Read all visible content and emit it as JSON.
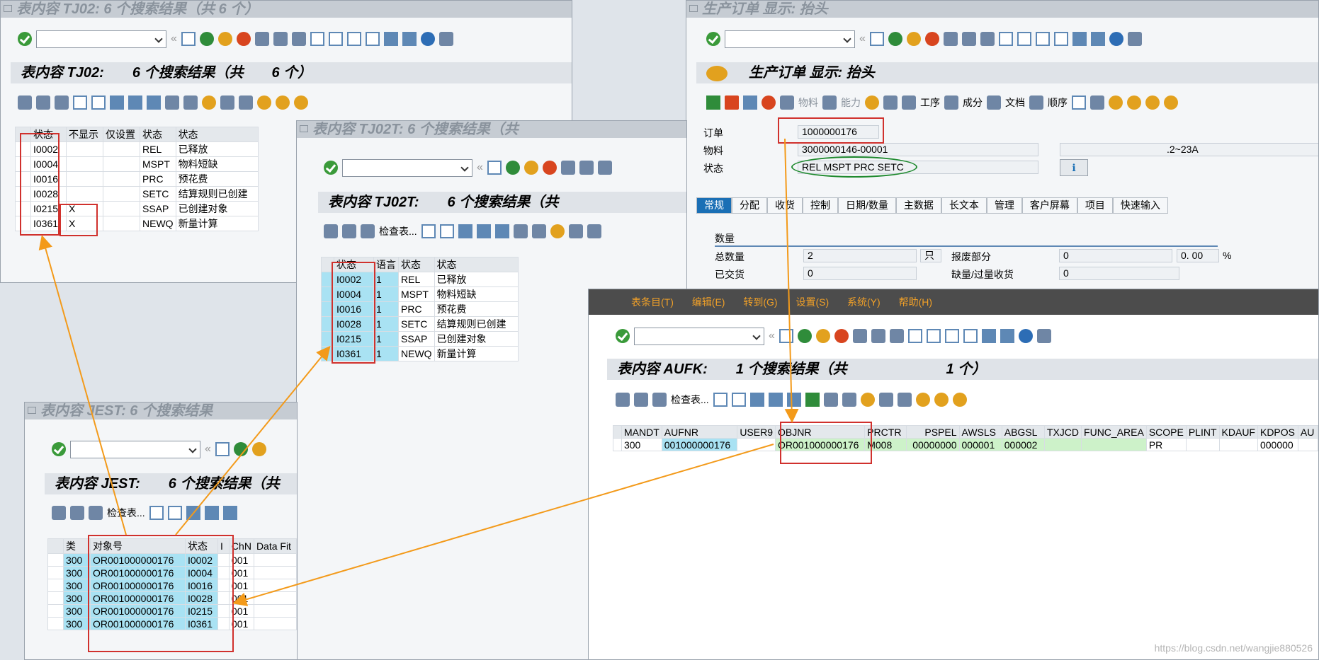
{
  "tj02_win": {
    "title": "表内容 TJ02:       6 个搜索结果（共            6 个）",
    "header": [
      "表内容 TJ02:",
      "6 个搜索结果（共",
      "6 个）"
    ],
    "columns": [
      "状态",
      "不显示",
      "仅设置",
      "状态",
      "状态"
    ],
    "rows": [
      [
        "I0002",
        "",
        "",
        "REL",
        "已释放"
      ],
      [
        "I0004",
        "",
        "",
        "MSPT",
        "物料短缺"
      ],
      [
        "I0016",
        "",
        "",
        "PRC",
        "预花费"
      ],
      [
        "I0028",
        "",
        "",
        "SETC",
        "结算规则已创建"
      ],
      [
        "I0215",
        "X",
        "",
        "SSAP",
        "已创建对象"
      ],
      [
        "I0361",
        "X",
        "",
        "NEWQ",
        "新量计算"
      ]
    ]
  },
  "tj02t_win": {
    "title": "表内容 TJ02T:      6 个搜索结果（共",
    "header": [
      "表内容 TJ02T:",
      "6 个搜索结果（共"
    ],
    "check_table": "检查表...",
    "columns": [
      "状态",
      "语言",
      "状态",
      "状态"
    ],
    "rows": [
      [
        "I0002",
        "1",
        "REL",
        "已释放"
      ],
      [
        "I0004",
        "1",
        "MSPT",
        "物料短缺"
      ],
      [
        "I0016",
        "1",
        "PRC",
        "预花费"
      ],
      [
        "I0028",
        "1",
        "SETC",
        "结算规则已创建"
      ],
      [
        "I0215",
        "1",
        "SSAP",
        "已创建对象"
      ],
      [
        "I0361",
        "1",
        "NEWQ",
        "新量计算"
      ]
    ]
  },
  "jest_win": {
    "title": "表内容 JEST:      6 个搜索结果",
    "header": [
      "表内容 JEST:",
      "6 个搜索结果（共"
    ],
    "check_table": "检查表...",
    "columns": [
      "类",
      "对象号",
      "状态",
      "I",
      "ChN",
      "Data Fit"
    ],
    "rows": [
      [
        "300",
        "OR001000000176",
        "I0002",
        "",
        "001",
        ""
      ],
      [
        "300",
        "OR001000000176",
        "I0004",
        "",
        "001",
        ""
      ],
      [
        "300",
        "OR001000000176",
        "I0016",
        "",
        "001",
        ""
      ],
      [
        "300",
        "OR001000000176",
        "I0028",
        "",
        "001",
        ""
      ],
      [
        "300",
        "OR001000000176",
        "I0215",
        "",
        "001",
        ""
      ],
      [
        "300",
        "OR001000000176",
        "I0361",
        "",
        "001",
        ""
      ]
    ]
  },
  "order_win": {
    "title": "生产订单 显示: 抬头",
    "header": "生产订单 显示: 抬头",
    "toolbar": [
      "物料",
      "能力",
      "工序",
      "成分",
      "文档",
      "顺序"
    ],
    "fields": {
      "order_label": "订单",
      "order_value": "1000000176",
      "material_label": "物料",
      "material_value": "3000000146-00001",
      "material_desc": ".2~23A",
      "status_label": "状态",
      "status_value": "REL  MSPT PRC  SETC"
    },
    "tabs": [
      "常规",
      "分配",
      "收货",
      "控制",
      "日期/数量",
      "主数据",
      "长文本",
      "管理",
      "客户屏幕",
      "项目",
      "快速输入"
    ],
    "qty": {
      "section": "数量",
      "total_label": "总数量",
      "total_value": "2",
      "unit": "只",
      "scrap_label": "报废部分",
      "scrap_value": "0",
      "scrap_pct": "0. 00",
      "pct": "%",
      "delivered_label": "已交货",
      "delivered_value": "0",
      "shortage_label": "缺量/过量收货",
      "shortage_value": "0"
    }
  },
  "aufk_win": {
    "menu": [
      "表条目(T)",
      "编辑(E)",
      "转到(G)",
      "设置(S)",
      "系统(Y)",
      "帮助(H)"
    ],
    "header": [
      "表内容 AUFK:",
      "1 个搜索结果（共",
      "1 个）"
    ],
    "check_table": "检查表...",
    "columns": [
      "MANDT",
      "AUFNR",
      "USER9",
      "OBJNR",
      "PRCTR",
      "PSPEL",
      "AWSLS",
      "ABGSL",
      "TXJCD",
      "FUNC_AREA",
      "SCOPE",
      "PLINT",
      "KDAUF",
      "KDPOS",
      "AU"
    ],
    "row": [
      "300",
      "001000000176",
      "",
      "OR001000000176",
      "M008",
      "00000000",
      "000001",
      "000002",
      "",
      "",
      "PR",
      "",
      "",
      "000000",
      ""
    ]
  },
  "watermark": "https://blog.csdn.net/wangjie880526",
  "colors": {
    "arrow": "#f39a1a",
    "redbox": "#d0312d",
    "cyan": "#a9e2f3",
    "green": "#cdf2c9"
  }
}
